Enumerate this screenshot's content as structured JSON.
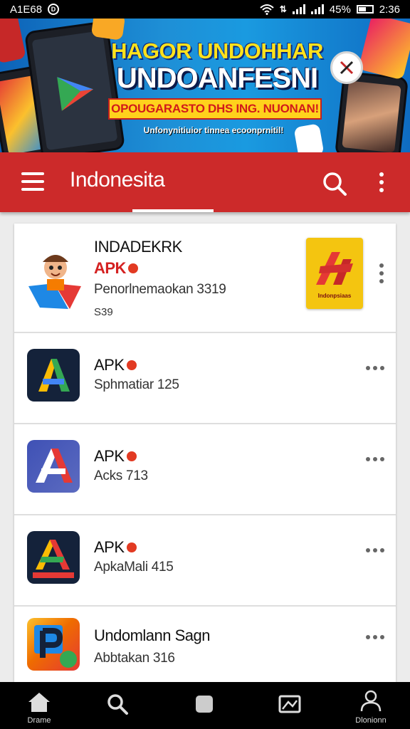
{
  "status_bar": {
    "carrier": "A1E68",
    "battery": "45%",
    "time": "2:36"
  },
  "banner": {
    "headline1": "HAGOR UNDOHHAR",
    "headline2": "UNDOANFESNI",
    "ribbon": "OPOUGARASTO DHS ING. NUONAN!",
    "tagline": "Unfonynitiuior tinnea ecoonprnitil!"
  },
  "app_bar": {
    "title": "Indonesita",
    "color": "#cc2a2a"
  },
  "apps": [
    {
      "name": "INDADEKRK",
      "badge": "APK",
      "subtitle": "Penorlnemaokan 3319",
      "size": "S39",
      "promo_label": "Indonpsiaas"
    },
    {
      "badge": "APK",
      "subtitle": "Sphmatiar 125"
    },
    {
      "badge": "APK",
      "subtitle": "Acks 713"
    },
    {
      "badge": "APK",
      "subtitle": "ApkaMali 415"
    },
    {
      "name": "Undomlann Sagn",
      "subtitle": "Abbtakan 316"
    }
  ],
  "bottom_nav": {
    "home_label": "Drame",
    "profile_label": "Dlonionn"
  },
  "colors": {
    "accent_red": "#d42121",
    "banner_blue": "#1a8fd6",
    "banner_yellow": "#ffe21c"
  }
}
